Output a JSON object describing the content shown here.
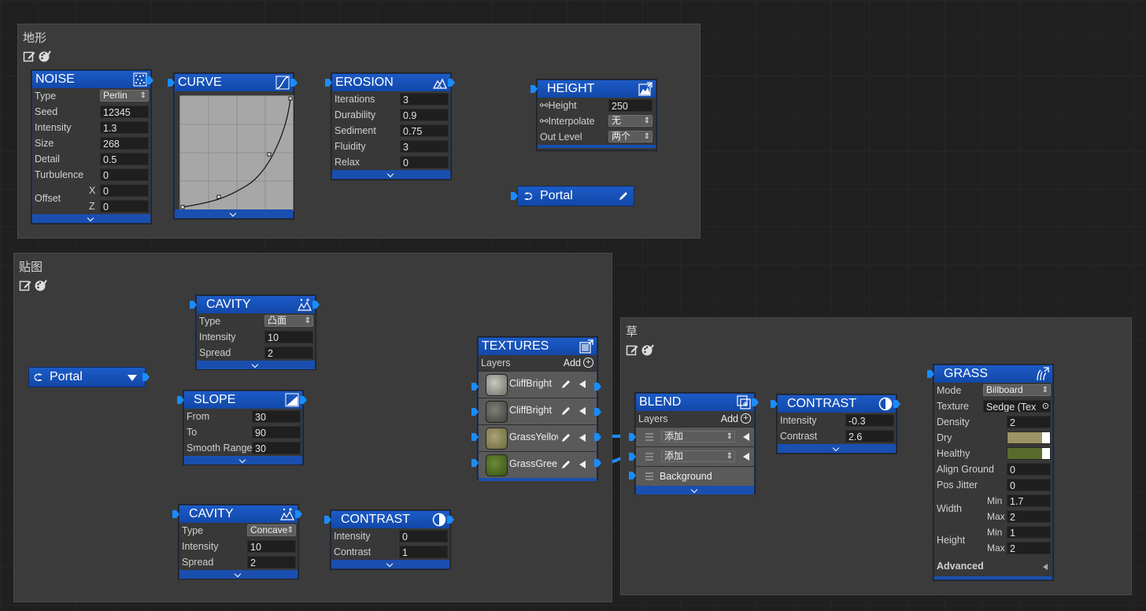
{
  "groups": {
    "terrain": {
      "title": "地形"
    },
    "texture": {
      "title": "贴图"
    },
    "grass": {
      "title": "草"
    }
  },
  "noise": {
    "title": "NOISE",
    "rows": [
      {
        "label": "Type",
        "value": "Perlin"
      },
      {
        "label": "Seed",
        "value": "12345"
      },
      {
        "label": "Intensity",
        "value": "1.3"
      },
      {
        "label": "Size",
        "value": "268"
      },
      {
        "label": "Detail",
        "value": "0.5"
      },
      {
        "label": "Turbulence",
        "value": "0"
      }
    ],
    "offset_label": "Offset",
    "offset_x_label": "X",
    "offset_x": "0",
    "offset_z_label": "Z",
    "offset_z": "0"
  },
  "curve": {
    "title": "CURVE"
  },
  "erosion": {
    "title": "EROSION",
    "rows": [
      {
        "label": "Iterations",
        "value": "3"
      },
      {
        "label": "Durability",
        "value": "0.9"
      },
      {
        "label": "Sediment",
        "value": "0.75"
      },
      {
        "label": "Fluidity",
        "value": "3"
      },
      {
        "label": "Relax",
        "value": "0"
      }
    ]
  },
  "height": {
    "title": "HEIGHT",
    "rows": [
      {
        "label": "Height",
        "value": "250"
      },
      {
        "label": "Interpolate",
        "value": "无"
      },
      {
        "label": "Out Level",
        "value": "两个"
      }
    ]
  },
  "portal_out": {
    "label": "Portal"
  },
  "portal_in": {
    "label": "Portal"
  },
  "cavity1": {
    "title": "CAVITY",
    "rows": [
      {
        "label": "Type",
        "value": "凸面"
      },
      {
        "label": "Intensity",
        "value": "10"
      },
      {
        "label": "Spread",
        "value": "2"
      }
    ]
  },
  "slope": {
    "title": "SLOPE",
    "rows": [
      {
        "label": "From",
        "value": "30"
      },
      {
        "label": "To",
        "value": "90"
      },
      {
        "label": "Smooth Range",
        "value": "30"
      }
    ]
  },
  "cavity2": {
    "title": "CAVITY",
    "rows": [
      {
        "label": "Type",
        "value": "Concave"
      },
      {
        "label": "Intensity",
        "value": "10"
      },
      {
        "label": "Spread",
        "value": "2"
      }
    ]
  },
  "contrast1": {
    "title": "CONTRAST",
    "rows": [
      {
        "label": "Intensity",
        "value": "0"
      },
      {
        "label": "Contrast",
        "value": "1"
      }
    ]
  },
  "textures": {
    "title": "TEXTURES",
    "layers_label": "Layers",
    "add_label": "Add",
    "layers": [
      {
        "name": "CliffBright",
        "color": "#8a8a82"
      },
      {
        "name": "CliffBright",
        "color": "#5e6258"
      },
      {
        "name": "GrassYellow",
        "color": "#8a8456"
      },
      {
        "name": "GrassGreen",
        "color": "#4f6a24"
      }
    ]
  },
  "blend": {
    "title": "BLEND",
    "layers_label": "Layers",
    "add_label": "Add",
    "layers": [
      {
        "mode": "添加"
      },
      {
        "mode": "添加"
      }
    ],
    "background_label": "Background"
  },
  "contrast2": {
    "title": "CONTRAST",
    "rows": [
      {
        "label": "Intensity",
        "value": "-0.3"
      },
      {
        "label": "Contrast",
        "value": "2.6"
      }
    ]
  },
  "grass": {
    "title": "GRASS",
    "mode_label": "Mode",
    "mode_value": "Billboard",
    "texture_label": "Texture",
    "texture_value": "Sedge (Tex",
    "density_label": "Density",
    "density_value": "2",
    "dry_label": "Dry",
    "dry_color": "#9c9466",
    "healthy_label": "Healthy",
    "healthy_color": "#5a6b2e",
    "align_label": "Align Ground",
    "align_value": "0",
    "jitter_label": "Pos Jitter",
    "jitter_value": "0",
    "width_label": "Width",
    "width_min_label": "Min",
    "width_min": "1.7",
    "width_max_label": "Max",
    "width_max": "2",
    "height_label": "Height",
    "height_min_label": "Min",
    "height_min": "1",
    "height_max_label": "Max",
    "height_max": "2",
    "advanced_label": "Advanced"
  },
  "colors": {
    "accent": "#1a8cff",
    "header": "#1248a8",
    "wire": "#1a8cff"
  }
}
